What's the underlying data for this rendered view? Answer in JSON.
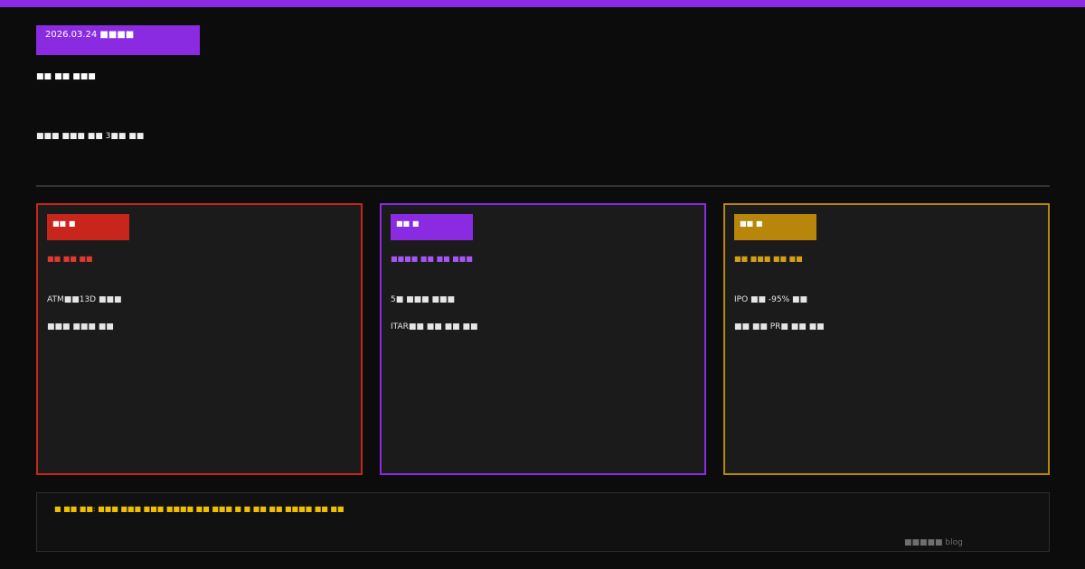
{
  "colors": {
    "accent": "#8a2be2",
    "red": "#c8261c",
    "purple": "#8a2be2",
    "gold": "#b8860b",
    "note": "#f0c000",
    "background": "#0c0c0c",
    "card_bg": "#1b1b1b"
  },
  "header": {
    "date_badge": "2026.03.24 ■■■■",
    "title": "■■ ■■ ■■■",
    "subtitle": "■■■ ■■■ ■■ 3■■ ■■"
  },
  "cards": [
    {
      "tag": "■■ ■",
      "headline": "■■ ■■ ■■",
      "lines": [
        "ATM■■13D ■■■",
        "■■■ ■■■ ■■"
      ]
    },
    {
      "tag": "■■ ■",
      "headline": "■■■■ ■■ ■■ ■■■",
      "lines": [
        "5■ ■■■ ■■■",
        "ITAR■■ ■■ ■■ ■■"
      ]
    },
    {
      "tag": "■■ ■",
      "headline": "■■ ■■■ ■■ ■■",
      "lines": [
        "IPO ■■ -95% ■■",
        "■■ ■■ PR■ ■■ ■■"
      ]
    }
  ],
  "footer": {
    "note": "■ ■■ ■■: ■■■ ■■■ ■■■ ■■■■ ■■ ■■■ ■ ■ ■■ ■■ ■■■■ ■■ ■■",
    "brand": "■■■■■ blog"
  }
}
